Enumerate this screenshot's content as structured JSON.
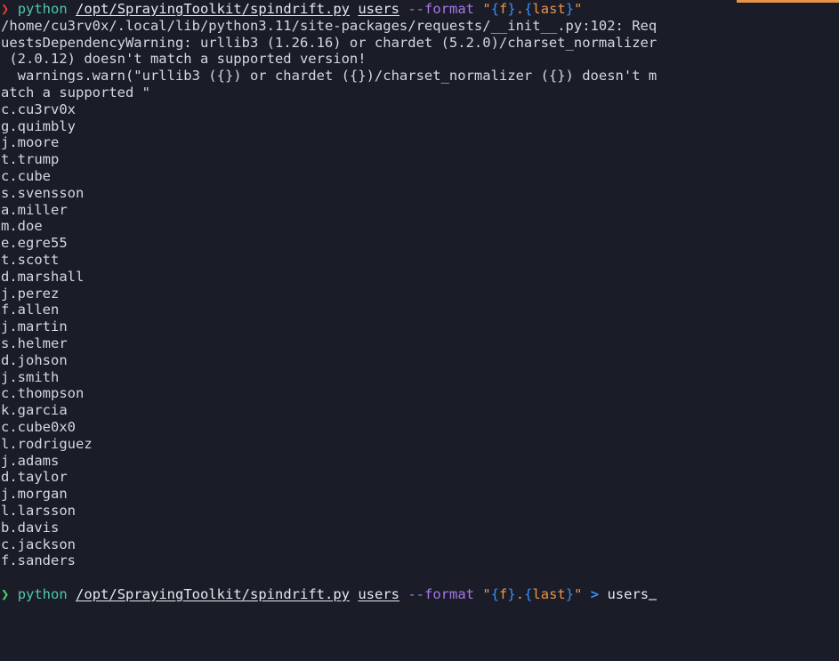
{
  "terminal": {
    "background_color": "#1a1c28",
    "foreground_color": "#d4d7e0",
    "accent_bar_color": "#e8954a",
    "prompt_error_color": "#e23a2e",
    "prompt_ok_color": "#4fd06a",
    "command_color": "#4fc7a8",
    "flag_color": "#a877e8",
    "string_color": "#e8954a",
    "brace_color": "#3d8df5"
  },
  "prompt_top": {
    "symbol": "❯",
    "command": "python",
    "script_path": "/opt/SprayingToolkit/spindrift.py",
    "subcommand": "users",
    "flag": "--format",
    "quote_open": "\"",
    "fmt_brace_open_1": "{",
    "fmt_token_1": "f",
    "fmt_brace_close_1": "}",
    "fmt_separator": ".",
    "fmt_brace_open_2": "{",
    "fmt_token_2": "last",
    "fmt_brace_close_2": "}",
    "quote_close": "\""
  },
  "warning_output": {
    "lines": [
      "/home/cu3rv0x/.local/lib/python3.11/site-packages/requests/__init__.py:102: Req",
      "uestsDependencyWarning: urllib3 (1.26.16) or chardet (5.2.0)/charset_normalizer",
      " (2.0.12) doesn't match a supported version!",
      "  warnings.warn(\"urllib3 ({}) or chardet ({})/charset_normalizer ({}) doesn't m",
      "atch a supported \""
    ]
  },
  "users_output": {
    "usernames": [
      "c.cu3rv0x",
      "g.quimbly",
      "j.moore",
      "t.trump",
      "c.cube",
      "s.svensson",
      "a.miller",
      "m.doe",
      "e.egre55",
      "t.scott",
      "d.marshall",
      "j.perez",
      "f.allen",
      "j.martin",
      "s.helmer",
      "d.johson",
      "j.smith",
      "c.thompson",
      "k.garcia",
      "c.cube0x0",
      "l.rodriguez",
      "j.adams",
      "d.taylor",
      "j.morgan",
      "l.larsson",
      "b.davis",
      "c.jackson",
      "f.sanders"
    ]
  },
  "prompt_bottom": {
    "symbol": "❯",
    "command": "python",
    "script_path": "/opt/SprayingToolkit/spindrift.py",
    "subcommand": "users",
    "flag": "--format",
    "quote_open": "\"",
    "fmt_brace_open_1": "{",
    "fmt_token_1": "f",
    "fmt_brace_close_1": "}",
    "fmt_separator": ".",
    "fmt_brace_open_2": "{",
    "fmt_token_2": "last",
    "fmt_brace_close_2": "}",
    "quote_close": "\"",
    "redirect": ">",
    "output_file": "users"
  }
}
